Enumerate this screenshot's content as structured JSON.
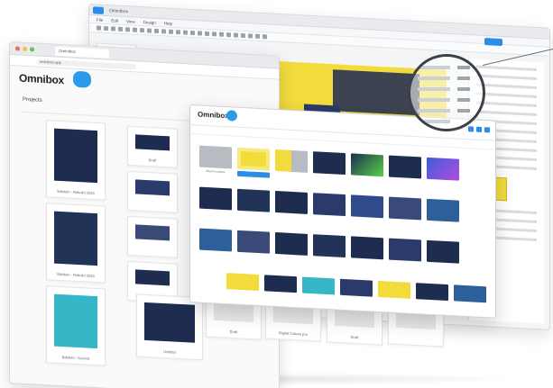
{
  "editor": {
    "title": "Ominibox",
    "menu": [
      "File",
      "Edit",
      "View",
      "Design",
      "Help"
    ]
  },
  "browser": {
    "tab_title": "Ominibox",
    "url": "ominibox.app",
    "brand": "Omnibox",
    "section_label": "Projects",
    "cards": [
      {
        "caption": "Baldwin - Rebuild 2023"
      },
      {
        "caption": "Baldwin - Rebuild 2023"
      },
      {
        "caption": "Baldwin - Ascend"
      },
      {
        "caption": "Draft"
      },
      {
        "caption": "Untitled"
      },
      {
        "caption": "Digital Culture pro"
      },
      {
        "caption": "Draft"
      },
      {
        "caption": "Draft"
      }
    ]
  },
  "picker": {
    "brand": "Omnibox",
    "select_label": "Select",
    "first_caption": "Blank template"
  },
  "colors": {
    "accent_blue": "#2a8de8",
    "brand_yellow": "#f2dc3c",
    "navy": "#1e2d4f"
  }
}
